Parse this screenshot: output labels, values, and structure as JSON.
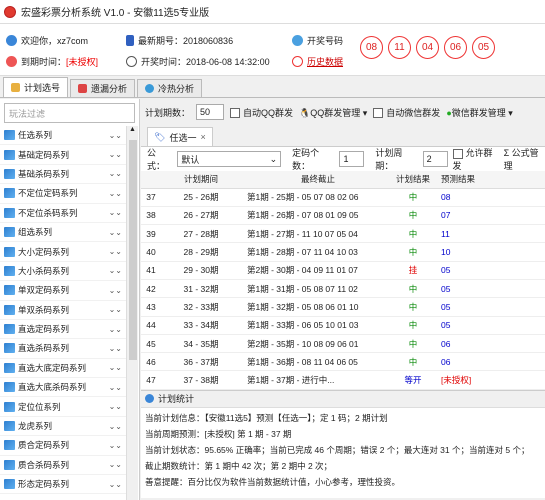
{
  "app": {
    "title": "宏盛彩票分析系统 V1.0 - 安徽11选5专业版"
  },
  "info": {
    "welcome_label": "欢迎你，",
    "username": "xz7com",
    "latest_label": "最新期号：",
    "latest_value": "2018060836",
    "draw_label": "开奖号码",
    "expire_label": "到期时间：",
    "expire_value": "[未授权]",
    "opentime_label": "开奖时间：",
    "opentime_value": "2018-06-08 14:32:00",
    "history_label": "历史数据",
    "balls": [
      "08",
      "11",
      "04",
      "06",
      "05"
    ]
  },
  "tabs": [
    {
      "label": "计划选号"
    },
    {
      "label": "遗漏分析"
    },
    {
      "label": "冷热分析"
    }
  ],
  "sidebar": {
    "filter_placeholder": "玩法过滤",
    "items": [
      {
        "label": "任选系列"
      },
      {
        "label": "基础定码系列"
      },
      {
        "label": "基础杀码系列"
      },
      {
        "label": "不定位定码系列"
      },
      {
        "label": "不定位杀码系列"
      },
      {
        "label": "组选系列"
      },
      {
        "label": "大小定码系列"
      },
      {
        "label": "大小杀码系列"
      },
      {
        "label": "单双定码系列"
      },
      {
        "label": "单双杀码系列"
      },
      {
        "label": "直选定码系列"
      },
      {
        "label": "直选杀码系列"
      },
      {
        "label": "直选大底定码系列"
      },
      {
        "label": "直选大底杀码系列"
      },
      {
        "label": "定位位系列"
      },
      {
        "label": "龙虎系列"
      },
      {
        "label": "质合定码系列"
      },
      {
        "label": "质合杀码系列"
      },
      {
        "label": "形态定码系列"
      }
    ]
  },
  "toolbar": {
    "plan_count_label": "计划期数：",
    "plan_count_value": "50",
    "auto_qq_label": "自动QQ群发",
    "qq_manage_label": "QQ群发管理",
    "auto_wechat_label": "自动微信群发",
    "wechat_manage_label": "微信群发管理"
  },
  "doc_tab": {
    "label": "任选一"
  },
  "options": {
    "formula_label": "公式：",
    "formula_value": "默认",
    "digits_label": "定码个数：",
    "digits_value": "1",
    "period_label": "计划周期：",
    "period_value": "2",
    "allow_group_label": "允许群发",
    "formula_manage_label": "公式管理"
  },
  "table": {
    "headers": [
      "",
      "计划期间",
      "最终截止",
      "计划结果",
      "预测结果"
    ],
    "rows": [
      {
        "no": "37",
        "period": "25 - 26期",
        "last": "第1期 - 25期 - 05 07 08 02 06",
        "result": "中",
        "pred": "08"
      },
      {
        "no": "38",
        "period": "26 - 27期",
        "last": "第1期 - 26期 - 07 08 01 09 05",
        "result": "中",
        "pred": "07"
      },
      {
        "no": "39",
        "period": "27 - 28期",
        "last": "第1期 - 27期 - 11 10 07 05 04",
        "result": "中",
        "pred": "11"
      },
      {
        "no": "40",
        "period": "28 - 29期",
        "last": "第1期 - 28期 - 07 11 04 10 03",
        "result": "中",
        "pred": "10"
      },
      {
        "no": "41",
        "period": "29 - 30期",
        "last": "第2期 - 30期 - 04 09 11 01 07",
        "result": "挂",
        "pred": "05"
      },
      {
        "no": "42",
        "period": "31 - 32期",
        "last": "第1期 - 31期 - 05 08 07 11 02",
        "result": "中",
        "pred": "05"
      },
      {
        "no": "43",
        "period": "32 - 33期",
        "last": "第1期 - 32期 - 05 08 06 01 10",
        "result": "中",
        "pred": "05"
      },
      {
        "no": "44",
        "period": "33 - 34期",
        "last": "第1期 - 33期 - 06 05 10 01 03",
        "result": "中",
        "pred": "05"
      },
      {
        "no": "45",
        "period": "34 - 35期",
        "last": "第2期 - 35期 - 10 08 09 06 01",
        "result": "中",
        "pred": "06"
      },
      {
        "no": "46",
        "period": "36 - 37期",
        "last": "第1期 - 36期 - 08 11 04 06 05",
        "result": "中",
        "pred": "06"
      },
      {
        "no": "47",
        "period": "37 - 38期",
        "last": "第1期 - 37期 - 进行中...",
        "result": "等开",
        "pred": "[未授权]"
      }
    ]
  },
  "stats": {
    "header": "计划统计",
    "line1": "当前计划信息：【安徽11选5】预测【任选一】；定 1 码；2 期计划",
    "line2": "当前周期预测：[未授权] 第 1 期 - 37 期",
    "line3": "当前计划状态：95.65% 正确率；当前已完成 46 个周期；错误 2 个；最大连对 31 个；当前连对 5 个；",
    "line4": "截止期数统计：第 1 期中 42 次；第 2 期中 2 次；",
    "line5": "善意提醒：百分比仅为软件当前数据统计值，小心参考，理性投资。"
  },
  "colors": {
    "accent": "#e03a2f",
    "win": "#0a8a0a",
    "lose": "#e00000",
    "pred": "#0000cc"
  }
}
